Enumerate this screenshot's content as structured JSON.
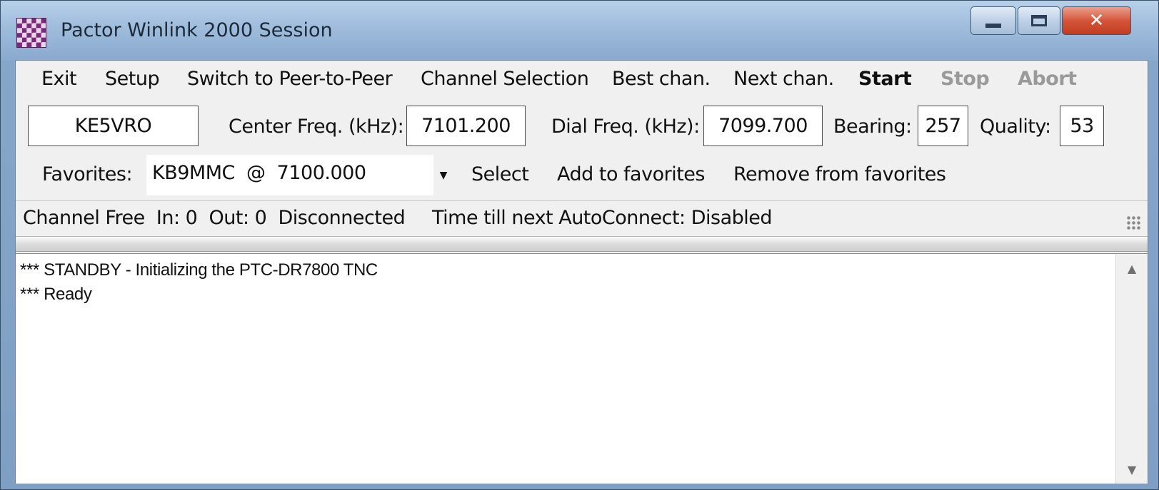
{
  "window": {
    "title": "Pactor Winlink 2000 Session"
  },
  "menu": {
    "items": [
      {
        "label": "Exit",
        "style": "normal"
      },
      {
        "label": "Setup",
        "style": "normal"
      },
      {
        "label": "Switch to Peer-to-Peer",
        "style": "normal"
      },
      {
        "label": "Channel Selection",
        "style": "normal"
      },
      {
        "label": "Best chan.",
        "style": "normal"
      },
      {
        "label": "Next chan.",
        "style": "normal"
      },
      {
        "label": "Start",
        "style": "bold"
      },
      {
        "label": "Stop",
        "style": "disabled"
      },
      {
        "label": "Abort",
        "style": "disabled"
      }
    ]
  },
  "fields": {
    "callsign": "KE5VRO",
    "center_freq_label": "Center Freq. (kHz):",
    "center_freq_value": "7101.200",
    "dial_freq_label": "Dial Freq. (kHz):",
    "dial_freq_value": "7099.700",
    "bearing_label": "Bearing:",
    "bearing_value": "257",
    "quality_label": "Quality:",
    "quality_value": "53"
  },
  "favorites": {
    "label": "Favorites:",
    "selected": "KB9MMC  @  7100.000",
    "select_button": "Select",
    "add_button": "Add to favorites",
    "remove_button": "Remove from favorites"
  },
  "status": {
    "left": "Channel Free  In: 0  Out: 0  Disconnected",
    "right": "Time till next AutoConnect: Disabled"
  },
  "log": {
    "lines": [
      "*** STANDBY - Initializing the PTC-DR7800 TNC",
      "*** Ready"
    ]
  },
  "icons": {
    "app": "checkered-app-icon",
    "minimize": "minimize-icon",
    "maximize": "maximize-icon",
    "close": "close-icon",
    "dropdown": "chevron-down-icon",
    "scroll_up": "scroll-up-icon",
    "scroll_down": "scroll-down-icon",
    "resize_grip": "resize-grip-icon"
  },
  "colors": {
    "disabled_text": "#9a9a9a",
    "close_button": "#c13d20"
  }
}
